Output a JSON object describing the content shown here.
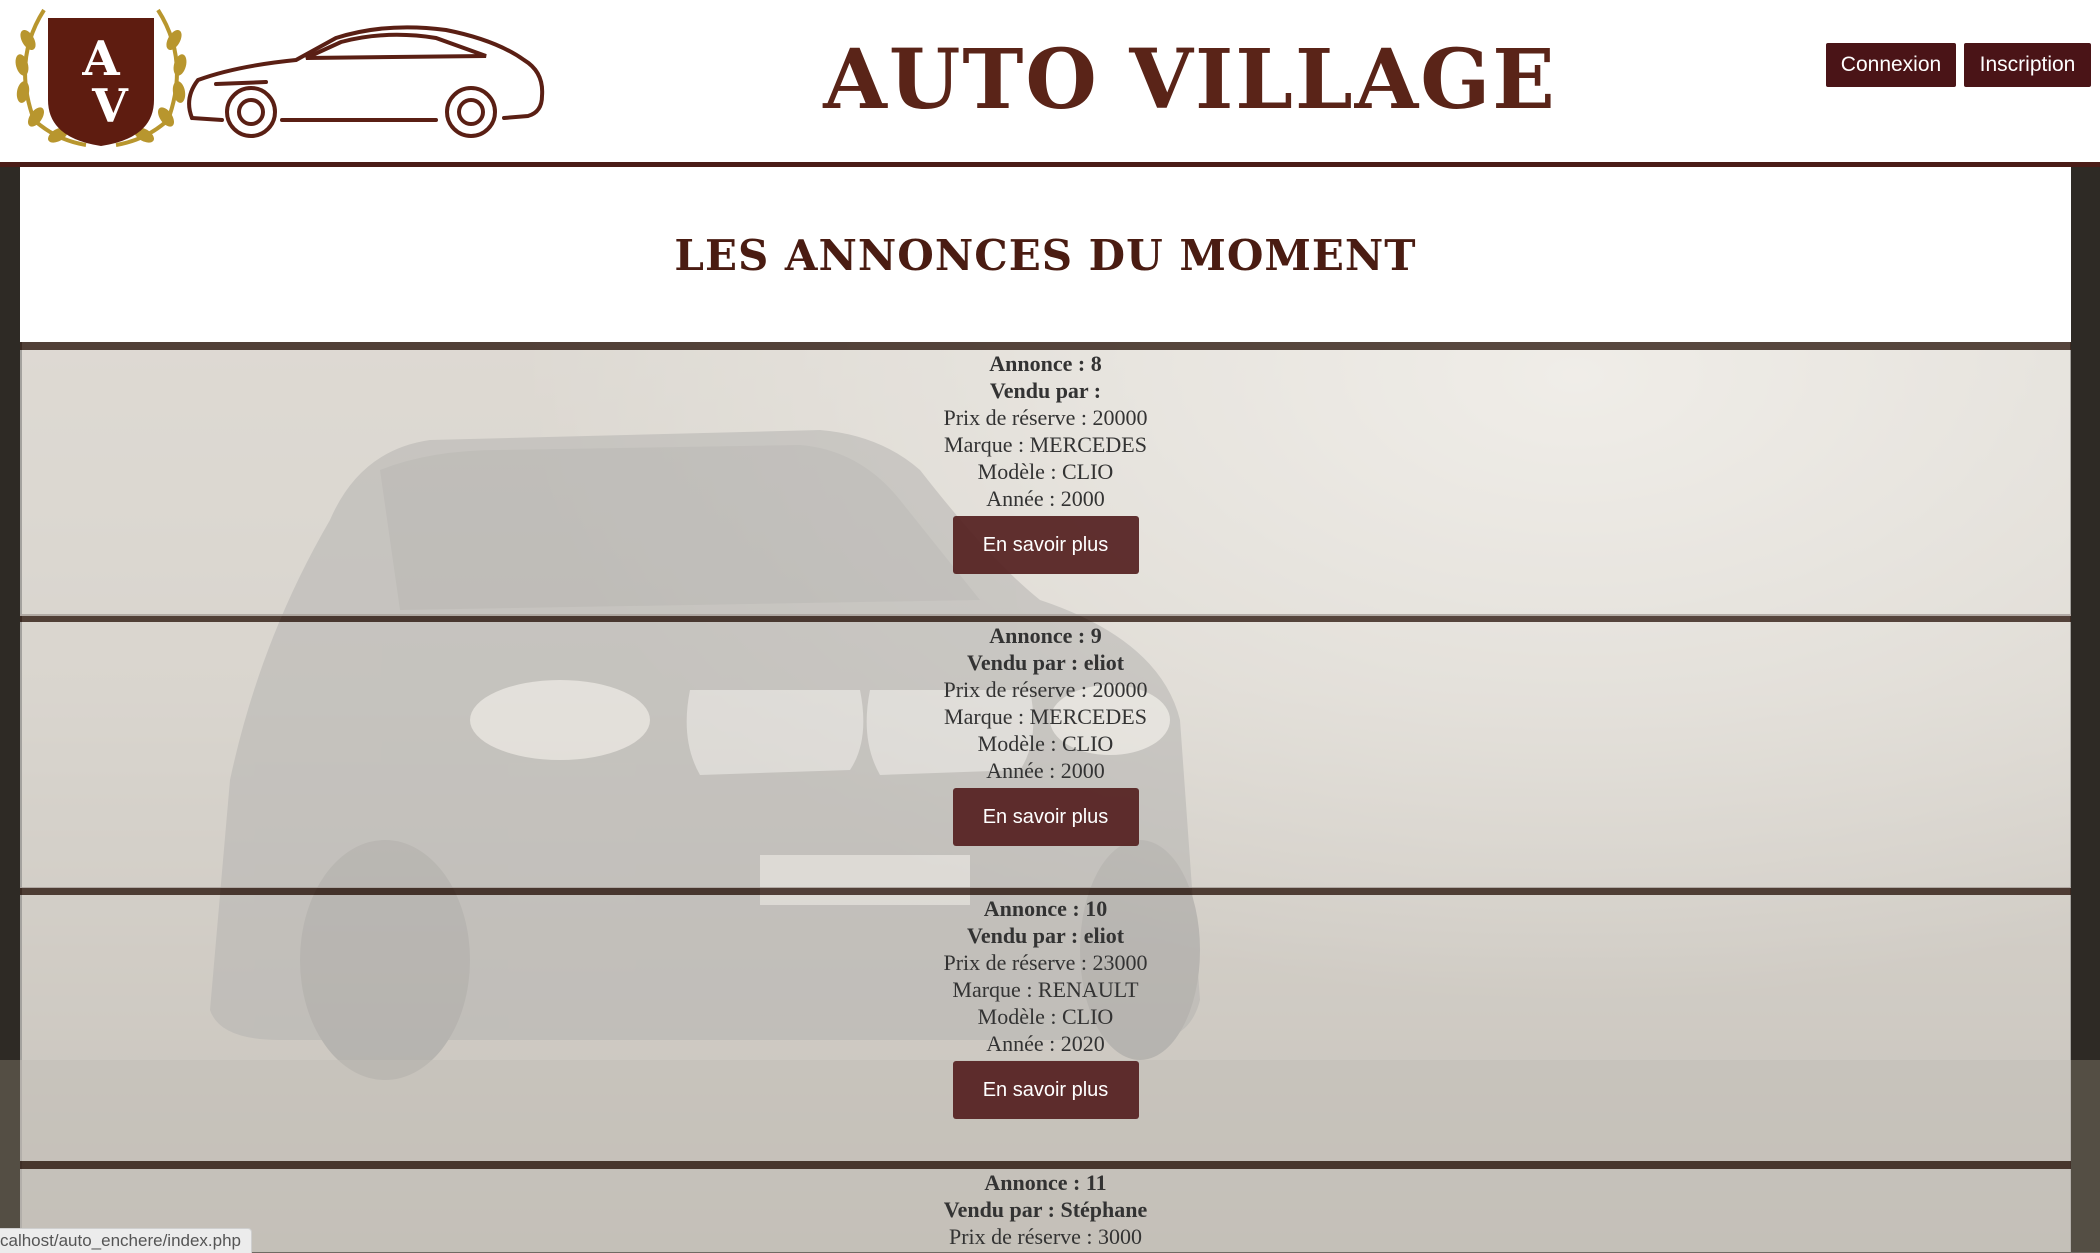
{
  "header": {
    "logo_initials": "AV",
    "site_title": "AUTO VILLAGE",
    "login_label": "Connexion",
    "register_label": "Inscription"
  },
  "main": {
    "section_title": "LES ANNONCES DU MOMENT",
    "listings": [
      {
        "annonce": "Annonce : 8",
        "seller": "Vendu par :",
        "price": "Prix de réserve : 20000",
        "brand": "Marque : MERCEDES",
        "model": "Modèle : CLIO",
        "year": "Année : 2000",
        "button": "En savoir plus"
      },
      {
        "annonce": "Annonce : 9",
        "seller": "Vendu par : eliot",
        "price": "Prix de réserve : 20000",
        "brand": "Marque : MERCEDES",
        "model": "Modèle : CLIO",
        "year": "Année : 2000",
        "button": "En savoir plus"
      },
      {
        "annonce": "Annonce : 10",
        "seller": "Vendu par : eliot",
        "price": "Prix de réserve : 23000",
        "brand": "Marque : RENAULT",
        "model": "Modèle : CLIO",
        "year": "Année : 2020",
        "button": "En savoir plus"
      },
      {
        "annonce": "Annonce : 11",
        "seller": "Vendu par : Stéphane",
        "price": "Prix de réserve : 3000",
        "brand": "",
        "model": "",
        "year": "",
        "button": ""
      }
    ]
  },
  "statusbar": {
    "url": "calhost/auto_enchere/index.php"
  },
  "colors": {
    "brand": "#4a1417",
    "title": "#5a2418",
    "laurel": "#b8962e"
  }
}
